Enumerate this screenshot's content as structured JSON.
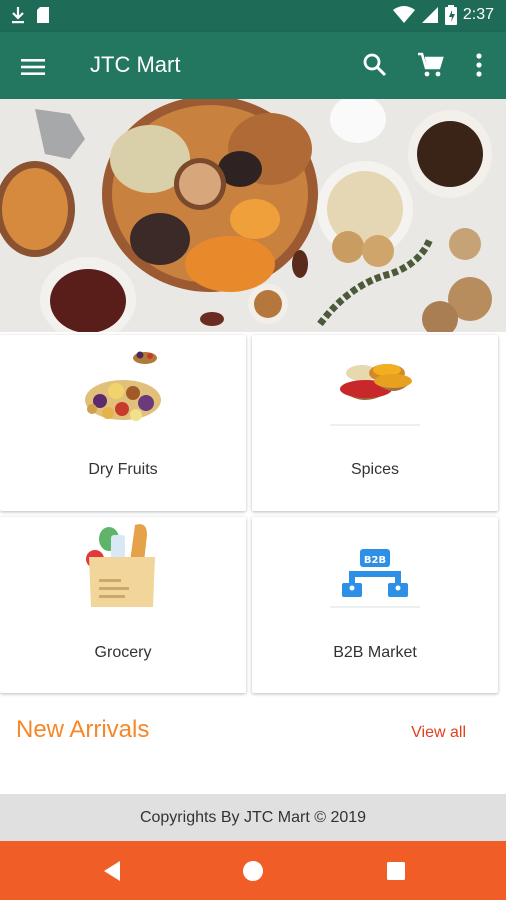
{
  "status_bar": {
    "time": "2:37"
  },
  "app_bar": {
    "title": "JTC Mart"
  },
  "categories": [
    {
      "label": "Dry Fruits"
    },
    {
      "label": "Spices"
    },
    {
      "label": "Grocery"
    },
    {
      "label": "B2B Market"
    }
  ],
  "b2b_badge": "B2B",
  "new_arrivals": {
    "title": "New Arrivals",
    "view_all": "View all"
  },
  "footer": {
    "text": "Copyrights By JTC Mart © 2019"
  },
  "colors": {
    "status_bar": "#1e6b58",
    "app_bar": "#23765f",
    "accent_orange": "#f5882a",
    "link_red": "#e2401f",
    "nav_bar": "#f15d26"
  }
}
